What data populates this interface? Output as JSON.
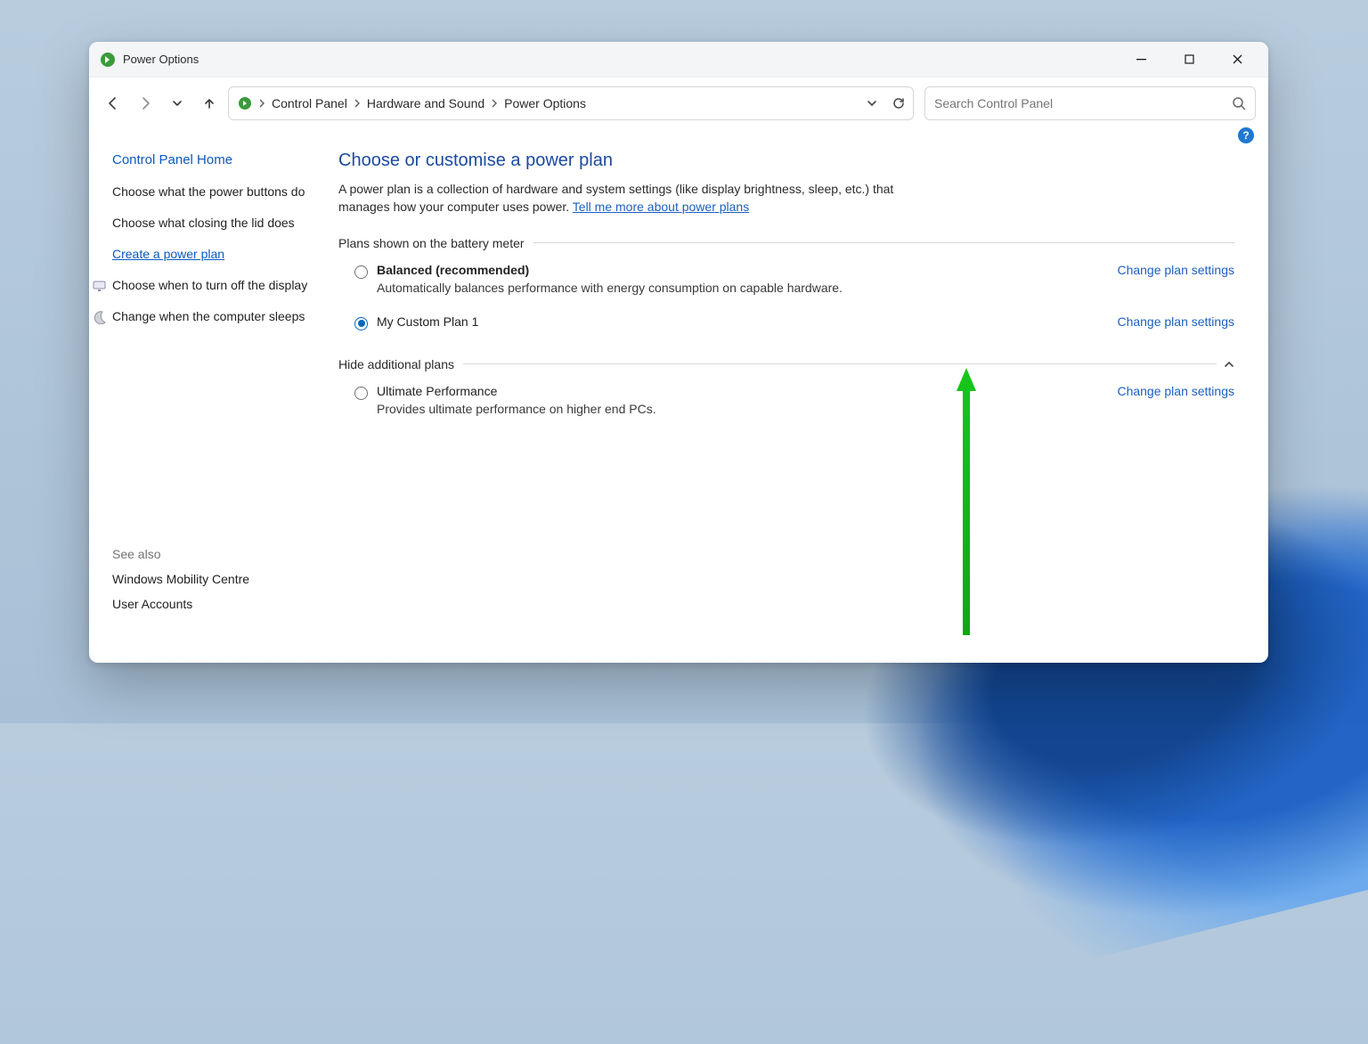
{
  "window": {
    "title": "Power Options"
  },
  "breadcrumb": {
    "items": [
      "Control Panel",
      "Hardware and Sound",
      "Power Options"
    ]
  },
  "search": {
    "placeholder": "Search Control Panel"
  },
  "help_char": "?",
  "leftnav": {
    "home": "Control Panel Home",
    "items": [
      {
        "label": "Choose what the power buttons do"
      },
      {
        "label": "Choose what closing the lid does"
      },
      {
        "label": "Create a power plan",
        "link": true
      },
      {
        "label": "Choose when to turn off the display",
        "icon": "display"
      },
      {
        "label": "Change when the computer sleeps",
        "icon": "sleep"
      }
    ],
    "see_also_label": "See also",
    "see_also": [
      "Windows Mobility Centre",
      "User Accounts"
    ]
  },
  "content": {
    "heading": "Choose or customise a power plan",
    "description_pre": "A power plan is a collection of hardware and system settings (like display brightness, sleep, etc.) that manages how your computer uses power. ",
    "description_link": "Tell me more about power plans",
    "shown_header": "Plans shown on the battery meter",
    "hidden_header": "Hide additional plans",
    "change_label": "Change plan settings",
    "plans_shown": [
      {
        "title": "Balanced (recommended)",
        "bold": true,
        "sub": "Automatically balances performance with energy consumption on capable hardware.",
        "selected": false
      },
      {
        "title": "My Custom Plan 1",
        "bold": false,
        "sub": "",
        "selected": true
      }
    ],
    "plans_hidden": [
      {
        "title": "Ultimate Performance",
        "bold": false,
        "sub": "Provides ultimate performance on higher end PCs.",
        "selected": false
      }
    ]
  }
}
